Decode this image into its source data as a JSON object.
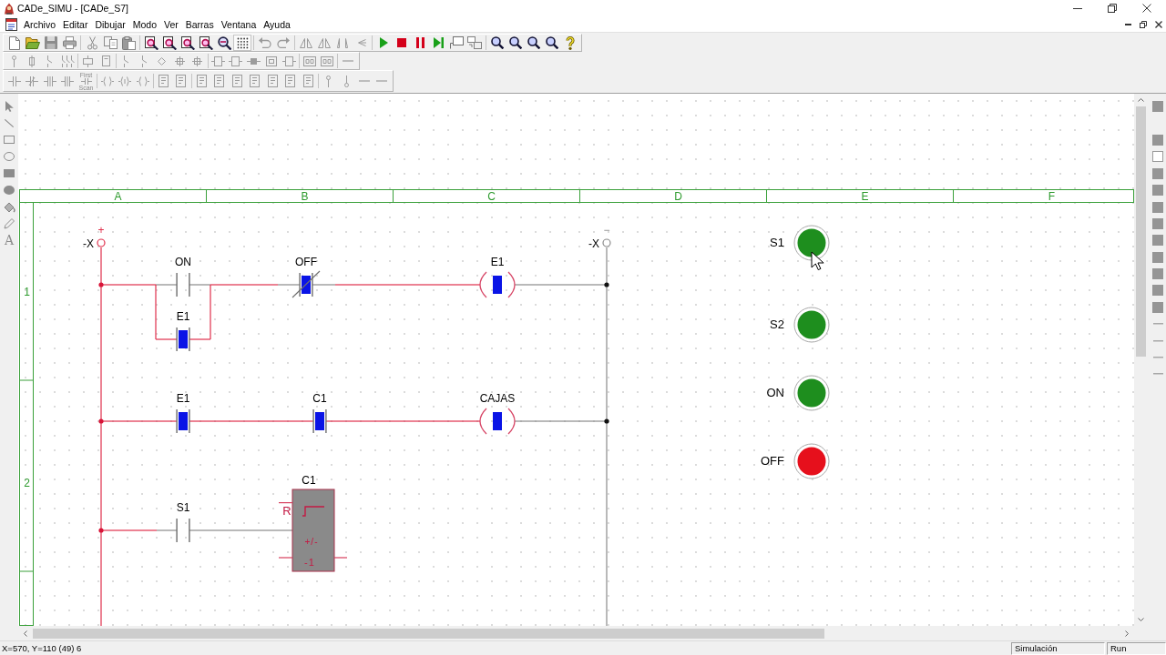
{
  "window": {
    "title": "CADe_SIMU - [CADe_S7]"
  },
  "menu": [
    "Archivo",
    "Editar",
    "Dibujar",
    "Modo",
    "Ver",
    "Barras",
    "Ventana",
    "Ayuda"
  ],
  "toolbar": {
    "grid": {
      "on": true
    },
    "first_scan": {
      "top": "First",
      "bottom": "Scan"
    }
  },
  "draw_tools": {
    "text_tool": "A"
  },
  "diagram": {
    "columns": [
      "A",
      "B",
      "C",
      "D",
      "E",
      "F"
    ],
    "rows": [
      "1",
      "2"
    ],
    "terminals": [
      {
        "sign": "+",
        "label": "-X",
        "energized": true
      },
      {
        "sign": "−",
        "label": "-X",
        "energized": false
      }
    ],
    "wires": [
      {
        "energized": true
      },
      {
        "energized": false
      },
      {
        "energized": true
      },
      {
        "energized": false
      },
      {
        "energized": false
      },
      {
        "energized": true
      },
      {
        "energized": false
      },
      {
        "energized": false
      },
      {
        "energized": true
      },
      {
        "energized": false
      },
      {
        "energized": true
      },
      {
        "energized": true
      },
      {
        "energized": true
      },
      {
        "energized": true
      },
      {
        "energized": true
      },
      {
        "energized": true
      },
      {
        "energized": true
      },
      {
        "energized": false
      },
      {
        "energized": true
      },
      {
        "energized": false
      },
      {
        "energized": false
      }
    ],
    "junctions": [
      {
        "energized": true
      },
      {
        "energized": false
      },
      {
        "energized": true
      },
      {
        "energized": false
      },
      {
        "energized": true
      }
    ],
    "contacts": [
      {
        "label": "ON",
        "kind": "no",
        "active": false
      },
      {
        "label": "E1",
        "kind": "no",
        "active": true
      },
      {
        "label": "OFF",
        "kind": "nc",
        "active": true
      },
      {
        "label": "E1",
        "kind": "no",
        "active": true
      },
      {
        "label": "C1",
        "kind": "no",
        "active": true
      },
      {
        "label": "S1",
        "kind": "no",
        "active": false
      }
    ],
    "coils": [
      {
        "label": "E1",
        "active": true
      },
      {
        "label": "CAJAS",
        "active": true
      }
    ],
    "counter": {
      "label": "C1",
      "reset_pin": "R",
      "mode": "+/-",
      "value": "-1"
    },
    "lights": [
      {
        "label": "S1",
        "color": "#1e8e1e"
      },
      {
        "label": "S2",
        "color": "#1e8e1e"
      },
      {
        "label": "ON",
        "color": "#1e8e1e"
      },
      {
        "label": "OFF",
        "color": "#e6101c"
      }
    ]
  },
  "status_bar": {
    "position": "X=570, Y=110 (49) 6",
    "mode": "Simulación",
    "state": "Run"
  }
}
